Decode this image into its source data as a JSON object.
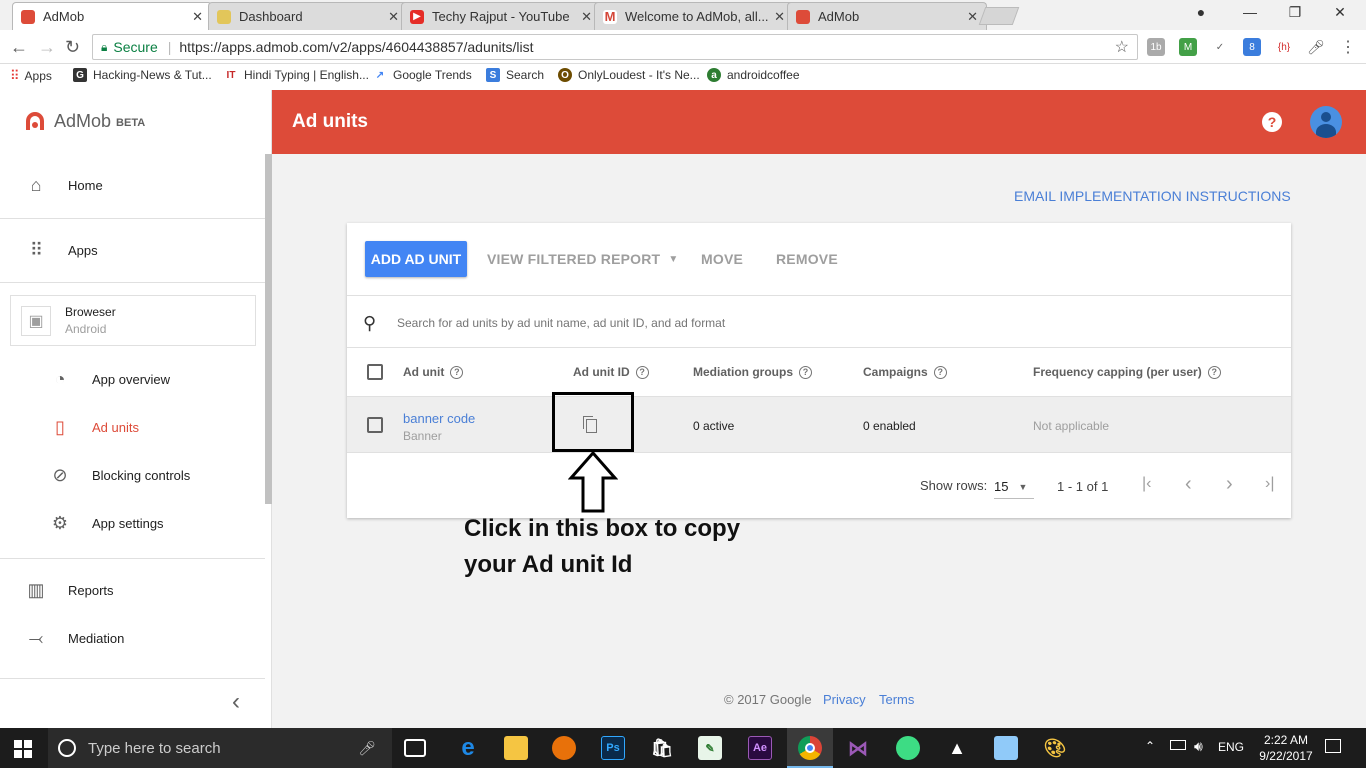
{
  "browser": {
    "tabs": [
      {
        "title": "AdMob",
        "color": "#dd4b39",
        "active": true
      },
      {
        "title": "Dashboard",
        "color": "#e2c65a",
        "active": false
      },
      {
        "title": "Techy Rajput - YouTube",
        "color": "#e52d27",
        "active": false
      },
      {
        "title": "Welcome to AdMob, all...",
        "color": "#d44638",
        "active": false
      },
      {
        "title": "AdMob",
        "color": "#dd4b39",
        "active": false
      }
    ],
    "secure_label": "Secure",
    "url": "https://apps.admob.com/v2/apps/4604438857/adunits/list",
    "bookmarks": [
      {
        "label": "Apps",
        "color": "#e53935"
      },
      {
        "label": "Hacking-News & Tut...",
        "color": "#333333"
      },
      {
        "label": "Hindi Typing | English...",
        "color": "#c62828"
      },
      {
        "label": "Google Trends",
        "color": "#4285f4"
      },
      {
        "label": "Search",
        "color": "#3b7ddd"
      },
      {
        "label": "OnlyLoudest - It's Ne...",
        "color": "#6d4c00"
      },
      {
        "label": "androidcoffee",
        "color": "#2e7d32"
      }
    ]
  },
  "sidebar": {
    "logo_text": "AdMob",
    "logo_beta": "BETA",
    "home_label": "Home",
    "apps_label": "Apps",
    "app_name": "Broweser",
    "app_platform": "Android",
    "sub_items": [
      {
        "label": "App overview",
        "icon": "gauge-icon",
        "glyph": "◔"
      },
      {
        "label": "Ad units",
        "icon": "ad-unit-icon",
        "glyph": "▯",
        "active": true
      },
      {
        "label": "Blocking controls",
        "icon": "block-icon",
        "glyph": "⊘"
      },
      {
        "label": "App settings",
        "icon": "settings-icon",
        "glyph": "⚙"
      }
    ],
    "reports_label": "Reports",
    "mediation_label": "Mediation",
    "collapse_glyph": "‹"
  },
  "header": {
    "title": "Ad units",
    "accent": "#dd4b39"
  },
  "main": {
    "email_link": "EMAIL IMPLEMENTATION INSTRUCTIONS",
    "add_ad_unit": "ADD AD UNIT",
    "view_filtered_report": "VIEW FILTERED REPORT",
    "move": "MOVE",
    "remove": "REMOVE",
    "search_placeholder": "Search for ad units by ad unit name, ad unit ID, and ad format",
    "columns": [
      "Ad unit",
      "Ad unit ID",
      "Mediation groups",
      "Campaigns",
      "Frequency capping (per user)"
    ],
    "row": {
      "name": "banner code",
      "format": "Banner",
      "mediation": "0 active",
      "campaigns": "0 enabled",
      "frequency": "Not applicable"
    },
    "show_rows_label": "Show rows:",
    "show_rows_value": "15",
    "page_range": "1 - 1 of 1",
    "annotation_line1": "Click in this box to copy",
    "annotation_line2": "your Ad unit Id",
    "footer_copyright": "© 2017 Google",
    "footer_privacy": "Privacy",
    "footer_terms": "Terms"
  },
  "taskbar": {
    "search_placeholder": "Type here to search",
    "language": "ENG",
    "time": "2:22 AM",
    "date": "9/22/2017"
  }
}
